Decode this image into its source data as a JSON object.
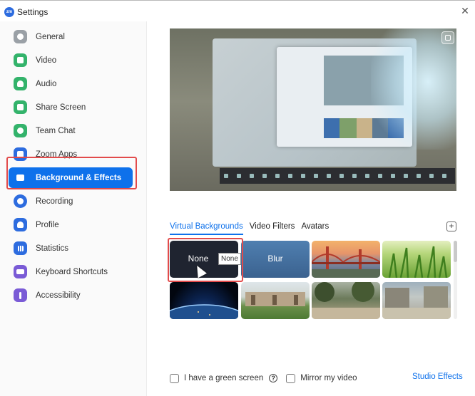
{
  "window": {
    "title": "Settings",
    "logo_text": "zm"
  },
  "sidebar": {
    "items": [
      {
        "label": "General",
        "color": "#9aa0a6",
        "active": false
      },
      {
        "label": "Video",
        "color": "#33b36b",
        "active": false
      },
      {
        "label": "Audio",
        "color": "#33b36b",
        "active": false
      },
      {
        "label": "Share Screen",
        "color": "#33b36b",
        "active": false
      },
      {
        "label": "Team Chat",
        "color": "#33b36b",
        "active": false
      },
      {
        "label": "Zoom Apps",
        "color": "#2d6cdf",
        "active": false
      },
      {
        "label": "Background & Effects",
        "color": "#ffffff",
        "active": true
      },
      {
        "label": "Recording",
        "color": "#2d6cdf",
        "active": false
      },
      {
        "label": "Profile",
        "color": "#2d6cdf",
        "active": false
      },
      {
        "label": "Statistics",
        "color": "#2d6cdf",
        "active": false
      },
      {
        "label": "Keyboard Shortcuts",
        "color": "#7a5bd6",
        "active": false
      },
      {
        "label": "Accessibility",
        "color": "#7a5bd6",
        "active": false
      }
    ]
  },
  "tabs": [
    {
      "label": "Virtual Backgrounds",
      "active": true
    },
    {
      "label": "Video Filters",
      "active": false
    },
    {
      "label": "Avatars",
      "active": false
    }
  ],
  "add_button": "+",
  "backgrounds": {
    "row1": [
      {
        "label": "None",
        "kind": "none"
      },
      {
        "label": "Blur",
        "kind": "blur"
      },
      {
        "label": "",
        "kind": "golden-gate"
      },
      {
        "label": "",
        "kind": "grass"
      }
    ],
    "row2": [
      {
        "label": "",
        "kind": "earth"
      },
      {
        "label": "",
        "kind": "campus-lawn"
      },
      {
        "label": "",
        "kind": "campus-trees"
      },
      {
        "label": "",
        "kind": "campus-plaza"
      }
    ],
    "tooltip": "None"
  },
  "options": {
    "green_screen_label": "I have a green screen",
    "help": "?",
    "mirror_label": "Mirror my video",
    "studio_effects": "Studio Effects"
  },
  "colors": {
    "accent": "#0e71eb",
    "highlight": "#e24b4b"
  }
}
